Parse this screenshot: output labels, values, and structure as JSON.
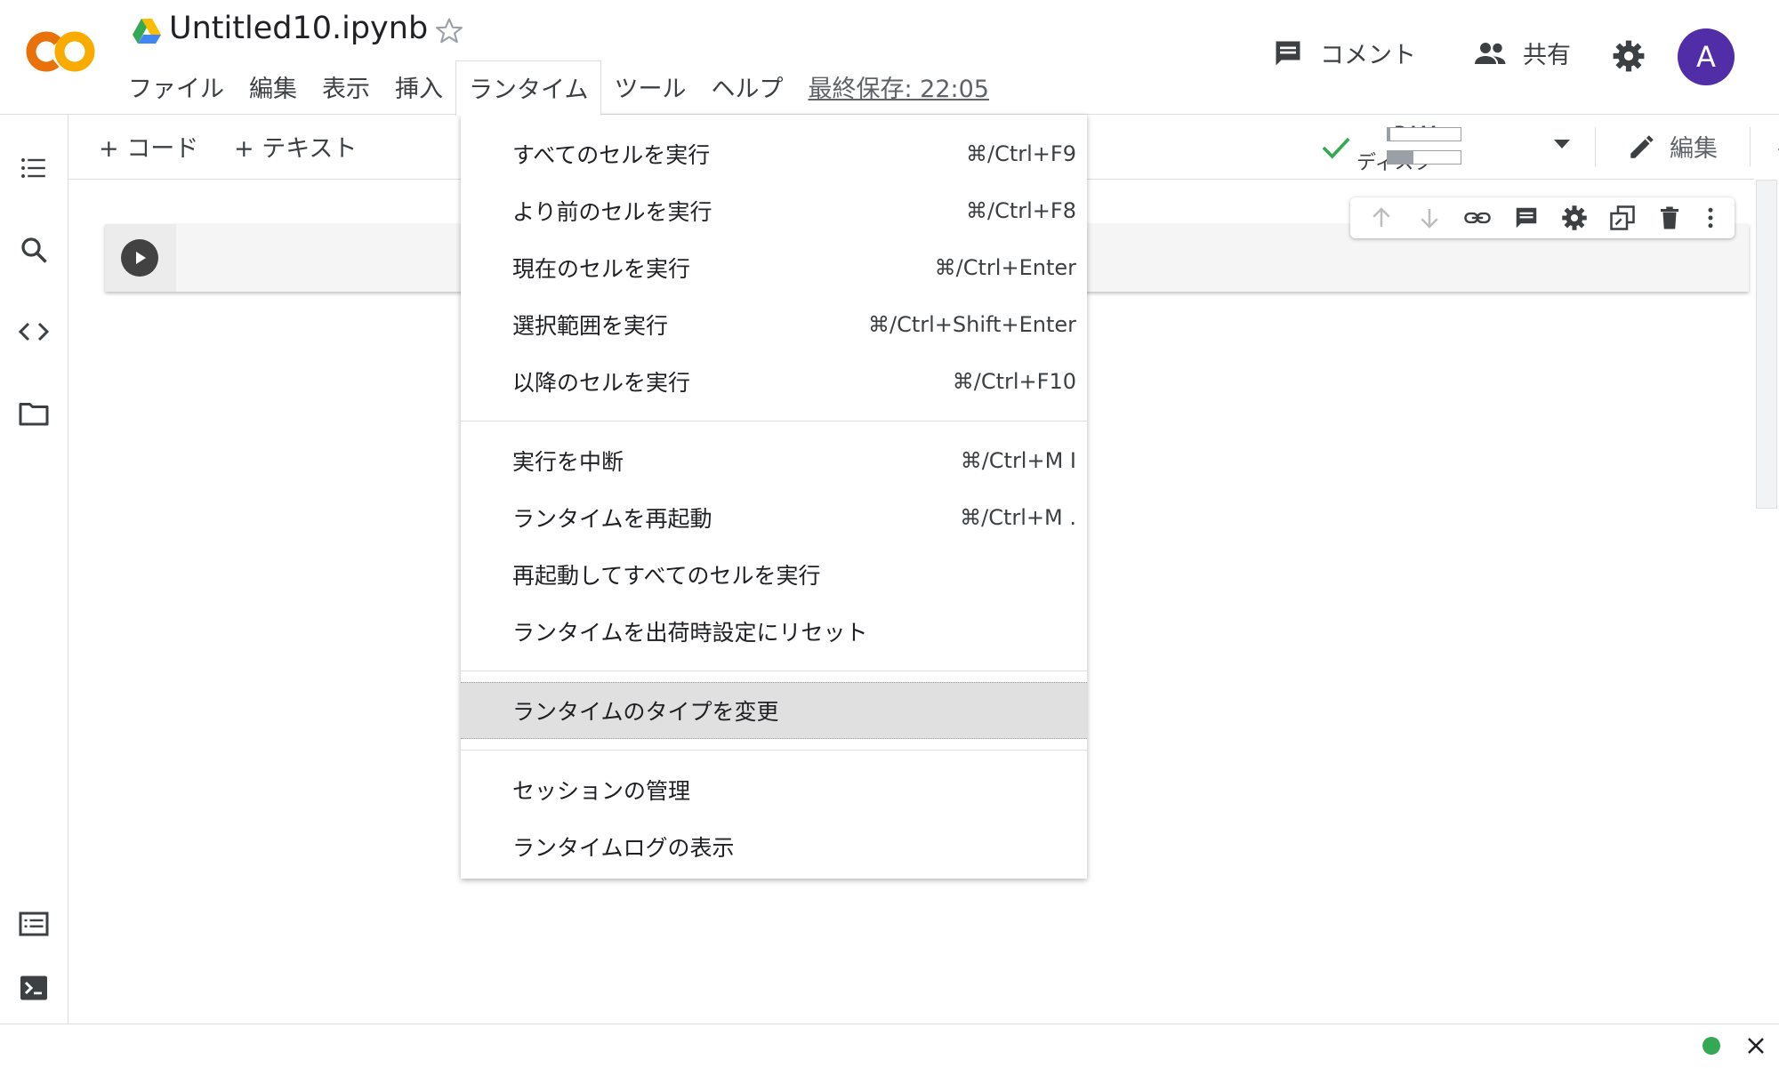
{
  "notebook": {
    "title": "Untitled10.ipynb"
  },
  "menubar": {
    "items": [
      "ファイル",
      "編集",
      "表示",
      "挿入",
      "ランタイム",
      "ツール",
      "ヘルプ"
    ],
    "last_saved": "最終保存: 22:05"
  },
  "header": {
    "comment_label": "コメント",
    "share_label": "共有",
    "avatar_letter": "A"
  },
  "toolbar": {
    "add_code": "+ コード",
    "add_text": "+ テキスト",
    "ram_label": "RAM",
    "disk_label": "ディスク",
    "ram_usage": 0.04,
    "disk_usage": 0.35,
    "edit_label": "編集"
  },
  "runtime_menu": {
    "groups": [
      [
        {
          "label": "すべてのセルを実行",
          "shortcut": "⌘/Ctrl+F9"
        },
        {
          "label": "より前のセルを実行",
          "shortcut": "⌘/Ctrl+F8"
        },
        {
          "label": "現在のセルを実行",
          "shortcut": "⌘/Ctrl+Enter"
        },
        {
          "label": "選択範囲を実行",
          "shortcut": "⌘/Ctrl+Shift+Enter"
        },
        {
          "label": "以降のセルを実行",
          "shortcut": "⌘/Ctrl+F10"
        }
      ],
      [
        {
          "label": "実行を中断",
          "shortcut": "⌘/Ctrl+M I"
        },
        {
          "label": "ランタイムを再起動",
          "shortcut": "⌘/Ctrl+M ."
        },
        {
          "label": "再起動してすべてのセルを実行",
          "shortcut": ""
        },
        {
          "label": "ランタイムを出荷時設定にリセット",
          "shortcut": ""
        }
      ],
      [
        {
          "label": "ランタイムのタイプを変更",
          "shortcut": "",
          "highlighted": true
        }
      ],
      [
        {
          "label": "セッションの管理",
          "shortcut": ""
        },
        {
          "label": "ランタイムログの表示",
          "shortcut": ""
        }
      ]
    ]
  },
  "colors": {
    "brand_orange": "#f9ab00",
    "brand_orange_dark": "#e8710a",
    "avatar_bg": "#512da8",
    "status_ok": "#34a853",
    "check_green": "#34a853"
  }
}
